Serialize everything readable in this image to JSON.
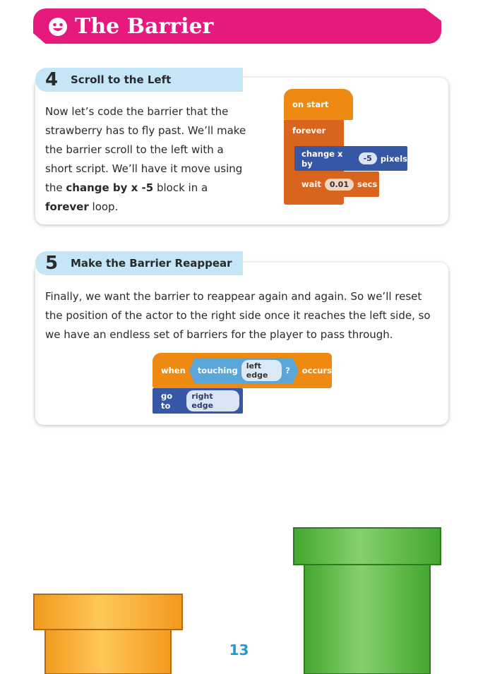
{
  "header": {
    "title": "The Barrier",
    "icon": "smiley-icon",
    "color": "#e6197d"
  },
  "step4": {
    "number": "4",
    "title": "Scroll to the Left",
    "text_plain_1": "Now let’s code the barrier that the strawberry has to fly past. We’ll make the barrier scroll to the left with a short script. We’ll have it move using the ",
    "text_bold_1": "change by x -5",
    "text_plain_2": " block in a ",
    "text_bold_2": "forever",
    "text_plain_3": " loop.",
    "code": {
      "hat": "on start",
      "loop": "forever",
      "change_label": "change x by",
      "change_value": "-5",
      "change_unit": "pixels",
      "wait_label": "wait",
      "wait_value": "0.01",
      "wait_unit": "secs"
    }
  },
  "step5": {
    "number": "5",
    "title": "Make the Barrier Reappear",
    "text": "Finally, we want the barrier to reappear again and again. So we’ll reset the position of the actor to the right side once it reaches the left side, so we have an endless set of barriers for the player to pass through.",
    "code": {
      "when": "when",
      "touching": "touching",
      "touching_target": "left edge",
      "question": "?",
      "occurs": "occurs",
      "goto": "go to",
      "goto_target": "right edge"
    }
  },
  "colors": {
    "event_orange": "#ee8a12",
    "control_orange": "#d9641e",
    "motion_blue": "#3656a6",
    "sensing_blue": "#5aa6d8",
    "tab_blue": "#c4e6f7",
    "pipe_orange": "#f5a623",
    "pipe_green": "#5cbf46",
    "page_number": "#1c9bd6"
  },
  "page_number": "13"
}
